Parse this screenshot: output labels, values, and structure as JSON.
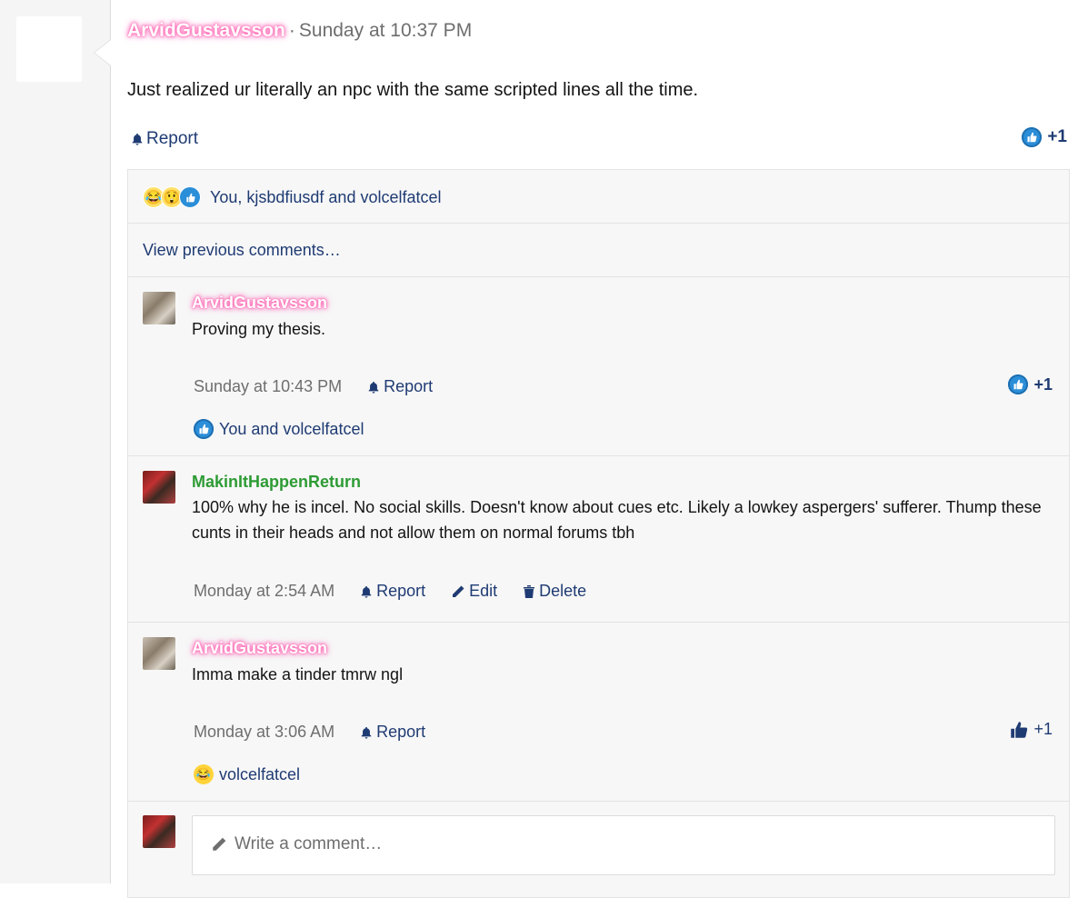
{
  "post": {
    "author": "ArvidGustavsson",
    "separator": "·",
    "time": "Sunday at 10:37 PM",
    "body": "Just realized ur literally an npc with the same scripted lines all the time.",
    "report_label": "Report",
    "react_count": "+1"
  },
  "reactions_summary": {
    "emojis": [
      "crying-laughing",
      "astonished",
      "like"
    ],
    "text": "You, kjsbdfiusdf and volcelfatcel"
  },
  "view_previous": "View previous comments…",
  "comments": [
    {
      "author": "ArvidGustavsson",
      "text": "Proving my thesis.",
      "time": "Sunday at 10:43 PM",
      "report_label": "Report",
      "react_count": "+1",
      "likes_text": "You and volcelfatcel"
    },
    {
      "author": "MakinItHappenReturn",
      "text": "100% why he is incel. No social skills. Doesn't know about cues etc. Likely a lowkey aspergers' sufferer. Thump these cunts in their heads and not allow them on normal forums tbh",
      "time": "Monday at 2:54 AM",
      "report_label": "Report",
      "edit_label": "Edit",
      "delete_label": "Delete"
    },
    {
      "author": "ArvidGustavsson",
      "text": "Imma make a tinder tmrw ngl",
      "time": "Monday at 3:06 AM",
      "report_label": "Report",
      "react_count": "+1",
      "likes_text": "volcelfatcel"
    }
  ],
  "composer": {
    "placeholder": "Write a comment…"
  },
  "colors": {
    "link": "#1f3b73",
    "pink_glow": "#ff69b4",
    "green_name": "#2e9b34",
    "like_blue": "#2b8ed8"
  }
}
